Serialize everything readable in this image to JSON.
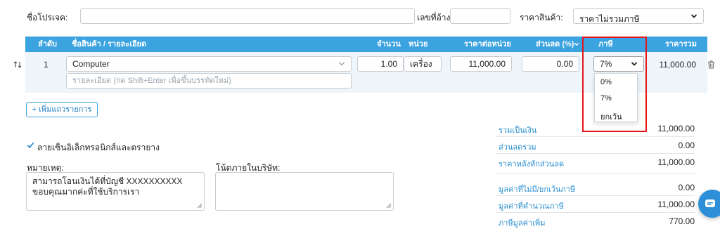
{
  "header": {
    "project_label": "ชื่อโปรเจค:",
    "project_value": "",
    "reference_label": "เลขที่อ้างอิง:",
    "reference_value": "",
    "price_label": "ราคาสินค้า:",
    "price_selected": "ราคาไม่รวมภาษี"
  },
  "table": {
    "headers": {
      "index": "ลำดับ",
      "name": "ชื่อสินค้า / รายละเอียด",
      "qty": "จำนวน",
      "unit": "หน่วย",
      "unit_price": "ราคาต่อหน่วย",
      "discount": "ส่วนลด (%)",
      "tax": "ภาษี",
      "total": "ราคารวม"
    },
    "rows": [
      {
        "index": "1",
        "name": "Computer",
        "detail_placeholder": "รายละเอียด (กด Shift+Enter เพื่อขึ้นบรรทัดใหม่)",
        "qty": "1.00",
        "unit": "เครื่อง",
        "unit_price": "11,000.00",
        "discount": "0.00",
        "tax": "7%",
        "total": "11,000.00"
      }
    ]
  },
  "tax_dropdown": {
    "options": [
      "0%",
      "7%",
      "ยกเว้น"
    ]
  },
  "add_row_label": "+ เพิ่มแถวรายการ",
  "esign_label": "ลายเซ็นอิเล็กทรอนิกส์และตรายาง",
  "notes": {
    "remark_label": "หมายเหตุ:",
    "remark_line1": "สามารถโอนเงินได้ที่บัญชี XXXXXXXXXX",
    "remark_line2": "ขอบคุณมากค่ะที่ใช้บริการเรา",
    "internal_label": "โน้ตภายในบริษัท:",
    "internal_value": ""
  },
  "summary": [
    {
      "label": "รวมเป็นเงิน",
      "value": "11,000.00"
    },
    {
      "label": "ส่วนลดรวม",
      "value": "0.00"
    },
    {
      "label": "ราคาหลังหักส่วนลด",
      "value": "11,000.00"
    },
    {
      "label": "มูลค่าที่ไม่มี/ยกเว้นภาษี",
      "value": "0.00"
    },
    {
      "label": "มูลค่าที่คำนวณภาษี",
      "value": "11,000.00"
    },
    {
      "label": "ภาษีมูลค่าเพิ่ม",
      "value": "770.00"
    }
  ],
  "colors": {
    "header_blue": "#3aa3e0",
    "row_bg": "#eef6fc",
    "highlight_red": "#e3161c",
    "link_blue": "#2a8fd0",
    "chat_blue": "#2d8fd8"
  },
  "icons": {
    "drag": "drag-handle-icon",
    "delete": "trash-icon",
    "chevron": "chevron-down-icon",
    "check": "check-icon",
    "chat": "chat-icon"
  }
}
